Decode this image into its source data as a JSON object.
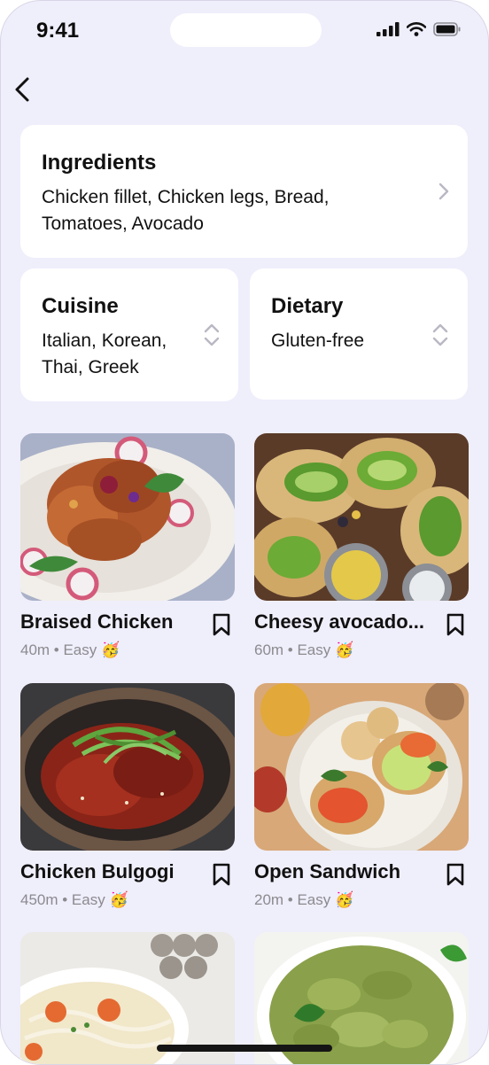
{
  "status_bar": {
    "time": "9:41"
  },
  "ingredients": {
    "title": "Ingredients",
    "line1": "Chicken fillet, Chicken legs, Bread,",
    "line2": "Tomatoes, Avocado"
  },
  "cuisine": {
    "title": "Cuisine",
    "line1": "Italian, Korean,",
    "line2": "Thai, Greek"
  },
  "dietary": {
    "title": "Dietary",
    "value": "Gluten-free"
  },
  "recipes": [
    {
      "name": "Braised Chicken",
      "meta": "40m • Easy 🥳"
    },
    {
      "name": "Cheesy avocado...",
      "meta": "60m • Easy 🥳"
    },
    {
      "name": "Chicken Bulgogi",
      "meta": "450m • Easy 🥳"
    },
    {
      "name": "Open Sandwich",
      "meta": "20m • Easy 🥳"
    }
  ],
  "colors": {
    "background": "#efeefb",
    "card": "#ffffff",
    "meta_text": "#8b8b8f"
  }
}
